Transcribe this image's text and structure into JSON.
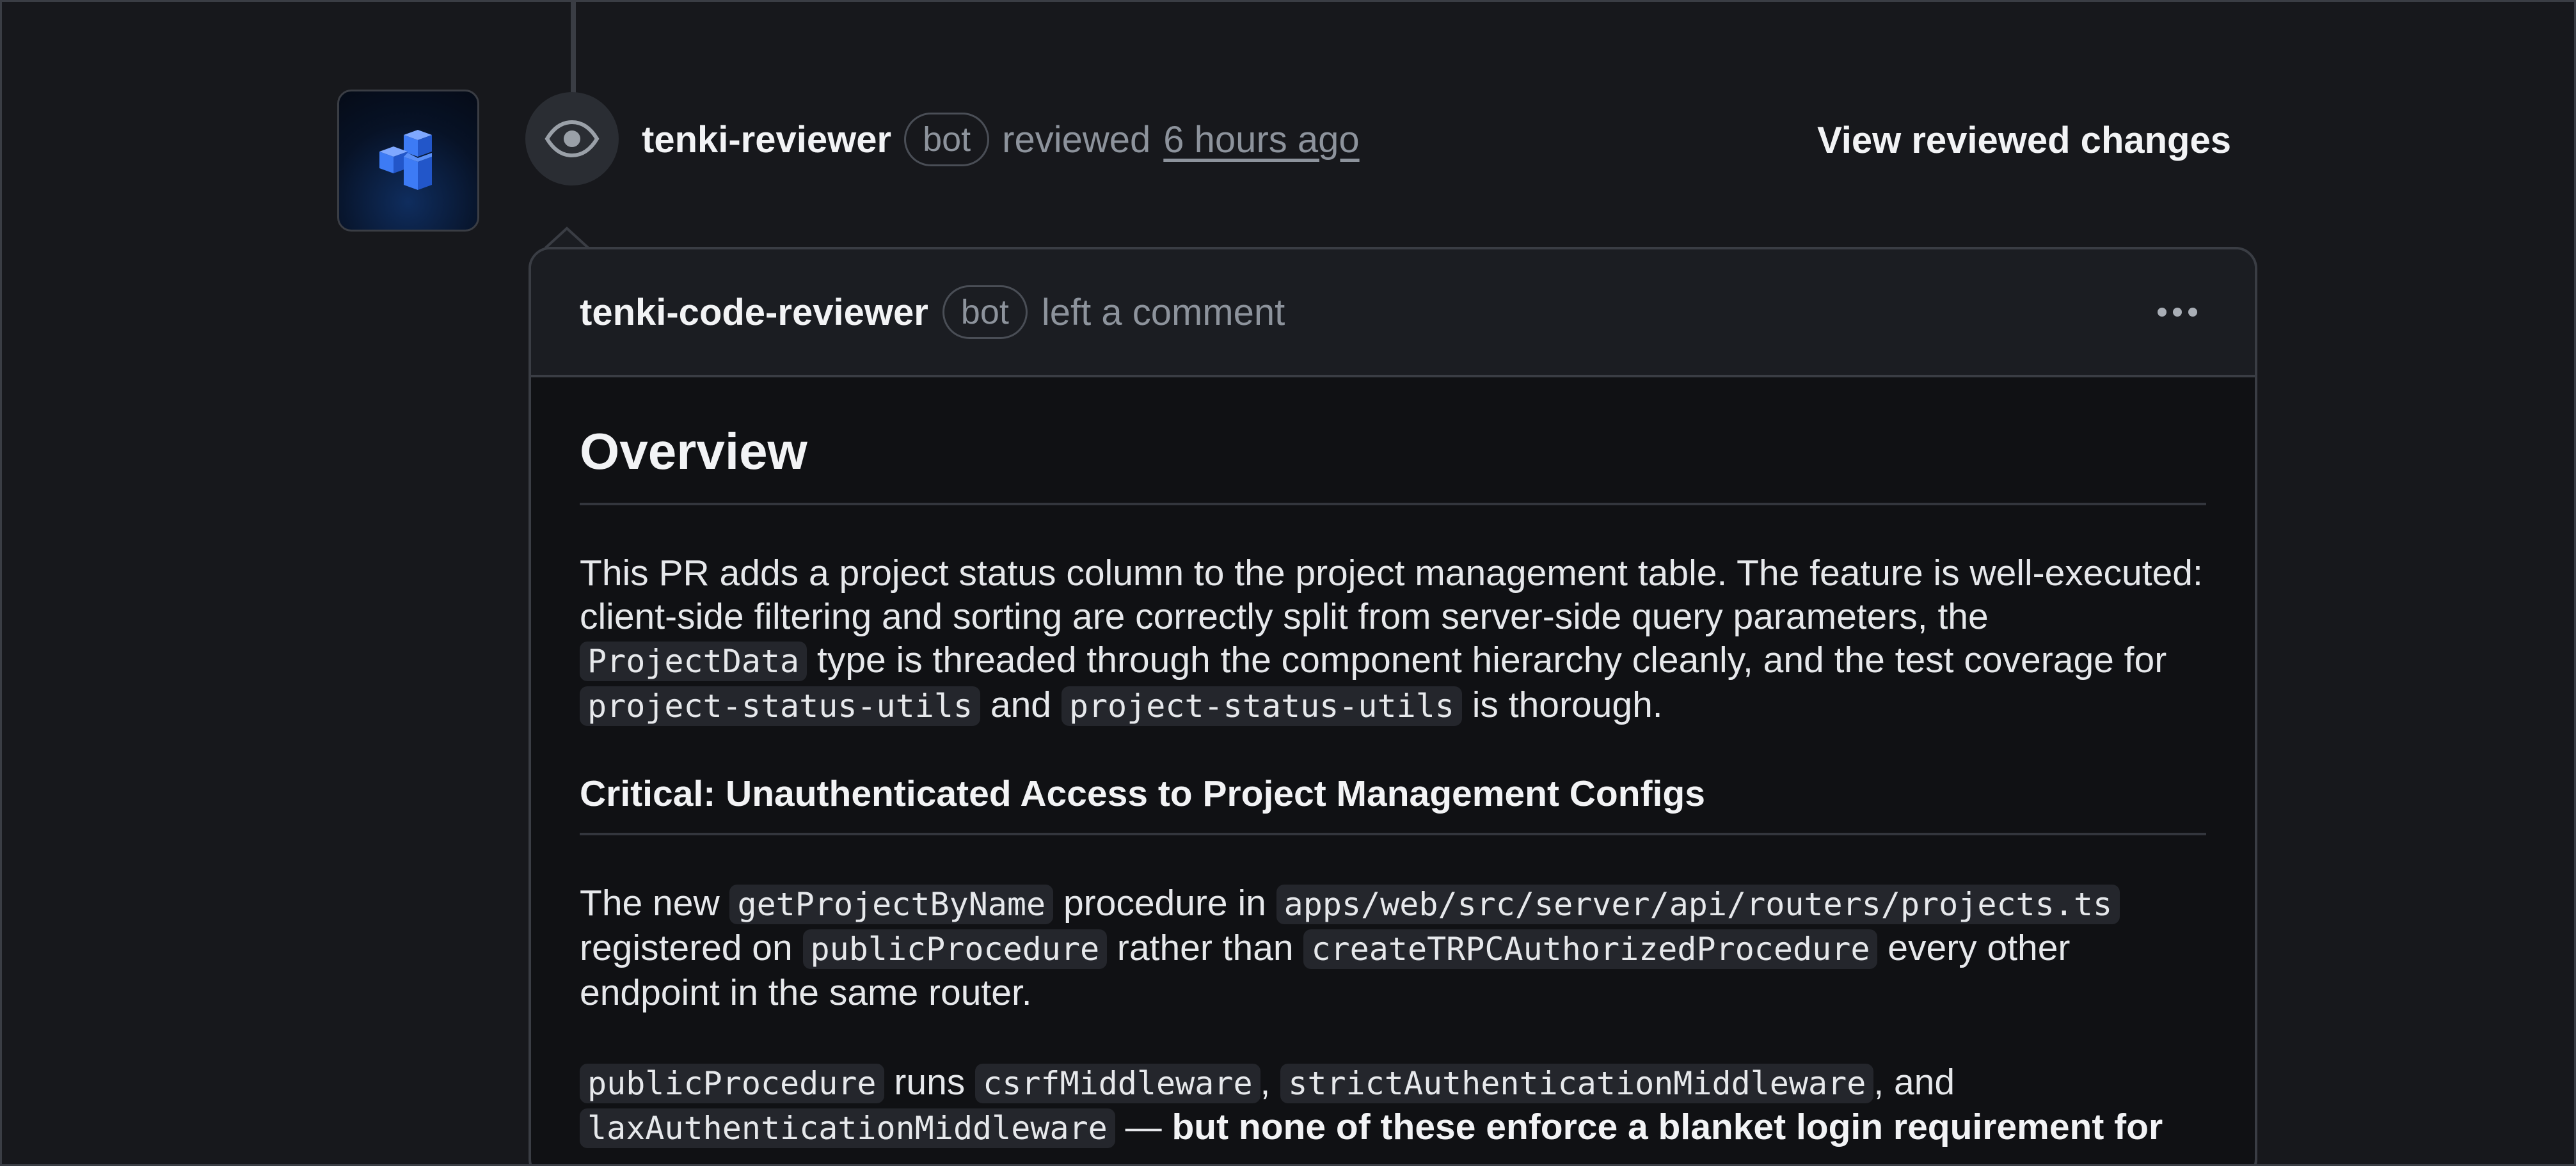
{
  "timeline": {
    "reviewer": "tenki-reviewer",
    "bot_badge": "bot",
    "action": "reviewed",
    "time": "6 hours ago",
    "view_changes": "View reviewed changes"
  },
  "comment": {
    "author": "tenki-code-reviewer",
    "bot_badge": "bot",
    "action": "left a comment",
    "overview_title": "Overview",
    "p1": {
      "t1": "This PR adds a project status column to the project management table. The feature is well-executed: client-side filtering and sorting are correctly split from server-side query parameters, the ",
      "c1": "ProjectData",
      "t2": " type is threaded through the component hierarchy cleanly, and the test coverage for ",
      "c2": "project-status-utils",
      "t3": " and ",
      "c3": "project-status-utils",
      "t4": " is thorough."
    },
    "critical_title": "Critical: Unauthenticated Access to Project Management Configs",
    "p2": {
      "t1": "The new ",
      "c1": "getProjectByName",
      "t2": " procedure in ",
      "c2": "apps/web/src/server/api/routers/projects.ts",
      "t3": " registered on ",
      "c3": "publicProcedure",
      "t4": " rather than ",
      "c4": "createTRPCAuthorizedProcedure",
      "t5": " every other endpoint in the same router."
    },
    "p3": {
      "c1": "publicProcedure",
      "t1": " runs ",
      "c2": "csrfMiddleware",
      "t2": ", ",
      "c3": "strictAuthenticationMiddleware",
      "t3": ", and ",
      "c4": "laxAuthenticationMiddleware",
      "t4": " — ",
      "b1": "but none of these enforce a blanket login requirement for"
    }
  },
  "colors": {
    "background": "#17181c",
    "card": "#101114",
    "border": "#3a3d44",
    "logo_blue": "#3d7bf5"
  },
  "icons": {
    "logo": "tenki-cubes-logo",
    "event": "eye-icon",
    "menu": "kebab-horizontal-icon"
  }
}
